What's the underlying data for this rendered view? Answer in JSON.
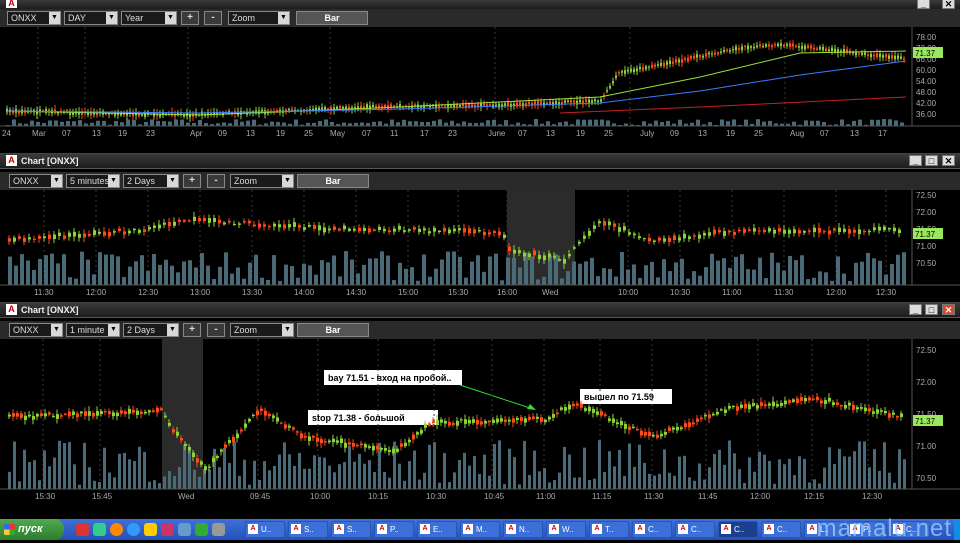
{
  "colors": {
    "up": "#8ed23a",
    "down": "#ff4a1a",
    "grid": "#3a3a3a",
    "axis_text": "#aaaaaa",
    "price_label": "#9ae65c",
    "volume": "#4a6a78"
  },
  "windows": [
    {
      "id": "w1",
      "title": "",
      "symbol": "ONXX",
      "interval": "DAY",
      "period": "Year",
      "zoom": "Zoom",
      "style_btn": "Bar",
      "plus": "+",
      "minus": "-",
      "x_labels": [
        "24",
        "Mar",
        "07",
        "13",
        "19",
        "23",
        "Apr",
        "09",
        "13",
        "19",
        "25",
        "May",
        "07",
        "11",
        "17",
        "23",
        "June",
        "07",
        "13",
        "19",
        "25",
        "July",
        "09",
        "13",
        "19",
        "25",
        "Aug",
        "07",
        "13",
        "17"
      ],
      "y_labels": [
        "78.00",
        "72.00",
        "66.00",
        "60.00",
        "54.00",
        "48.00",
        "42.00",
        "36.00"
      ],
      "last_price": "71.37"
    },
    {
      "id": "w2",
      "title": "Chart [ONXX]",
      "symbol": "ONXX",
      "interval": "5 minutes",
      "period": "2 Days",
      "zoom": "Zoom",
      "style_btn": "Bar",
      "plus": "+",
      "minus": "-",
      "x_labels": [
        "11:30",
        "12:00",
        "12:30",
        "13:00",
        "13:30",
        "14:00",
        "14:30",
        "15:00",
        "15:30",
        "16:00",
        "Wed",
        "10:00",
        "10:30",
        "11:00",
        "11:30",
        "12:00",
        "12:30"
      ],
      "y_labels": [
        "72.50",
        "72.00",
        "71.50",
        "71.00",
        "70.50"
      ],
      "last_price": "71.37"
    },
    {
      "id": "w3",
      "title": "Chart [ONXX]",
      "symbol": "ONXX",
      "interval": "1 minute",
      "period": "2 Days",
      "zoom": "Zoom",
      "style_btn": "Bar",
      "plus": "+",
      "minus": "-",
      "x_labels": [
        "15:30",
        "15:45",
        "Wed",
        "09:45",
        "10:00",
        "10:15",
        "10:30",
        "10:45",
        "11:00",
        "11:15",
        "11:30",
        "11:45",
        "12:00",
        "12:15",
        "12:30"
      ],
      "y_labels": [
        "72.50",
        "72.00",
        "71.50",
        "71.00",
        "70.50"
      ],
      "last_price": "71.37",
      "annotations": {
        "buy": "bay 71.51 - вход на пробой..",
        "stop": "stop 71.38 - большой",
        "exit": "вышел по 71.59"
      }
    }
  ],
  "taskbar": {
    "start_label": "пуск",
    "watermark": "mamalu.net",
    "buttons": [
      "U..",
      "S..",
      "S..",
      "P..",
      "E..",
      "M..",
      "N..",
      "W..",
      "T..",
      "C..",
      "C..",
      "C..",
      "C..",
      "L..",
      "P..",
      "C.."
    ]
  }
}
